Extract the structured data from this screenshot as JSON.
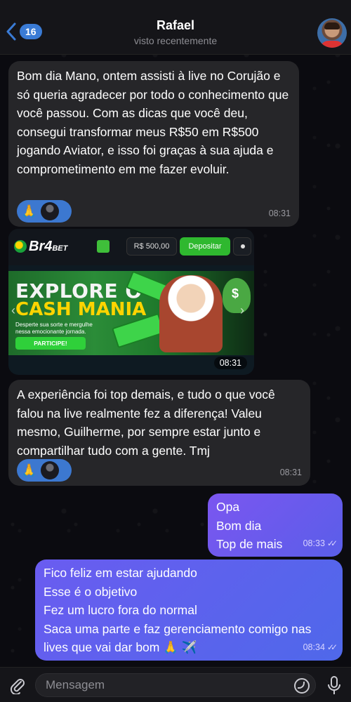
{
  "header": {
    "back_count": "16",
    "name": "Rafael",
    "status": "visto recentemente"
  },
  "messages": [
    {
      "id": "m1",
      "direction": "in",
      "text": "Bom dia Mano, ontem assisti à live no Corujão e só queria agradecer por todo o conhecimento que você passou. Com as dicas que você deu, consegui transformar meus R$50 em R$500 jogando Aviator, e isso foi graças à sua ajuda e comprometimento em me fazer evoluir.",
      "reaction": "🙏",
      "time": "08:31"
    },
    {
      "id": "m2",
      "direction": "in",
      "type": "image",
      "time": "08:31",
      "image": {
        "logo_main": "Br4",
        "logo_suffix": "BET",
        "balance": "R$ 500,00",
        "deposit_label": "Depositar",
        "headline_1": "EXPLORE O",
        "headline_2": "CASH MANIA",
        "subline": "Desperte sua sorte e mergulhe nessa emocionante jornada.",
        "cta": "PARTICIPE!"
      }
    },
    {
      "id": "m3",
      "direction": "in",
      "text": "A experiência foi top demais, e tudo o que você falou na live realmente fez a diferença! Valeu mesmo, Guilherme, por sempre estar junto e compartilhar tudo com a gente. Tmj",
      "reaction": "🙏",
      "time": "08:31"
    },
    {
      "id": "m4",
      "direction": "out",
      "lines": [
        "Opa",
        "Bom dia",
        "Top de mais"
      ],
      "time": "08:33"
    },
    {
      "id": "m5",
      "direction": "out",
      "lines": [
        "Fico feliz em estar ajudando",
        "Esse é o objetivo",
        "Fez um lucro fora do normal",
        "Saca uma parte e faz gerenciamento comigo nas lives que vai dar bom 🙏 ✈️"
      ],
      "time": "08:34"
    }
  ],
  "composer": {
    "placeholder": "Mensagem"
  },
  "colors": {
    "incoming_bubble": "#262629",
    "outgoing_bubble_start": "#7b56f0",
    "outgoing_bubble_end": "#5a5ee9",
    "accent": "#3a7bd5"
  }
}
